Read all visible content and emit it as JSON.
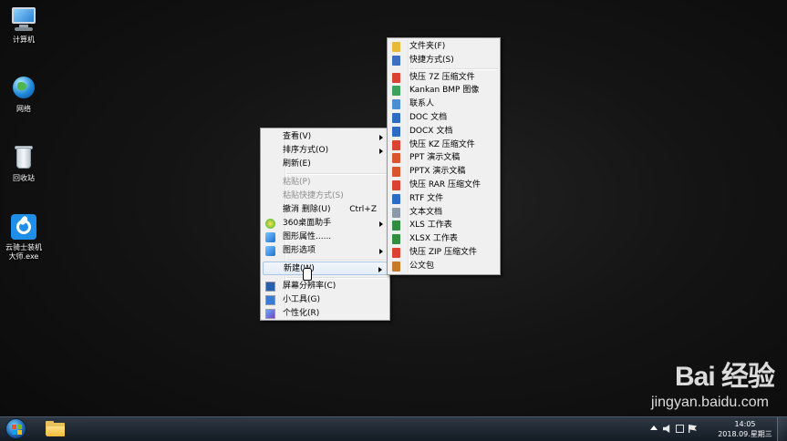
{
  "desktop_icons": [
    {
      "label": "计算机",
      "icon": "computer-icon"
    },
    {
      "label": "网络",
      "icon": "network-icon"
    },
    {
      "label": "回收站",
      "icon": "recycle-bin-icon"
    },
    {
      "label_line1": "云骑士装机",
      "label_line2": "大师.exe",
      "icon": "yunqishi-app-icon"
    }
  ],
  "context_menu": {
    "items": [
      {
        "label": "查看(V)",
        "submenu": true
      },
      {
        "label": "排序方式(O)",
        "submenu": true
      },
      {
        "label": "刷新(E)"
      },
      {
        "label": "粘贴(P)",
        "disabled": true
      },
      {
        "label": "粘贴快捷方式(S)",
        "disabled": true
      },
      {
        "label": "撤消 删除(U)",
        "shortcut": "Ctrl+Z"
      },
      {
        "label": "360桌面助手",
        "submenu": true,
        "icon": "360-icon"
      },
      {
        "label": "图形属性......",
        "icon": "graphics-icon"
      },
      {
        "label": "图形选项",
        "submenu": true,
        "icon": "graphics-options-icon"
      },
      {
        "label": "新建(W)",
        "submenu": true,
        "highlighted": true
      },
      {
        "label": "屏幕分辨率(C)",
        "icon": "screen-resolution-icon"
      },
      {
        "label": "小工具(G)",
        "icon": "gadgets-icon"
      },
      {
        "label": "个性化(R)",
        "icon": "personalize-icon"
      }
    ]
  },
  "new_submenu": {
    "items": [
      {
        "label": "文件夹(F)",
        "icon": "folder-icon",
        "color": "#e9b93a"
      },
      {
        "label": "快捷方式(S)",
        "icon": "shortcut-icon",
        "color": "#3a6fc4"
      },
      {
        "label": "快压 7Z 压缩文件",
        "icon": "archive-icon",
        "color": "#d9432f"
      },
      {
        "label": "Kankan BMP 图像",
        "icon": "image-icon",
        "color": "#3aa35c"
      },
      {
        "label": "联系人",
        "icon": "contact-icon",
        "color": "#4a8fd6"
      },
      {
        "label": "DOC 文档",
        "icon": "doc-icon",
        "color": "#2b6cc4"
      },
      {
        "label": "DOCX 文档",
        "icon": "docx-icon",
        "color": "#2b6cc4"
      },
      {
        "label": "快压 KZ 压缩文件",
        "icon": "archive-icon",
        "color": "#d9432f"
      },
      {
        "label": "PPT 演示文稿",
        "icon": "ppt-icon",
        "color": "#d8572a"
      },
      {
        "label": "PPTX 演示文稿",
        "icon": "pptx-icon",
        "color": "#d8572a"
      },
      {
        "label": "快压 RAR 压缩文件",
        "icon": "archive-icon",
        "color": "#d9432f"
      },
      {
        "label": "RTF 文件",
        "icon": "rtf-icon",
        "color": "#2b6cc4"
      },
      {
        "label": "文本文档",
        "icon": "text-icon",
        "color": "#8a9aa8"
      },
      {
        "label": "XLS 工作表",
        "icon": "xls-icon",
        "color": "#2f8f3e"
      },
      {
        "label": "XLSX 工作表",
        "icon": "xlsx-icon",
        "color": "#2f8f3e"
      },
      {
        "label": "快压 ZIP 压缩文件",
        "icon": "archive-icon",
        "color": "#d9432f"
      },
      {
        "label": "公文包",
        "icon": "briefcase-icon",
        "color": "#c77a2a"
      }
    ]
  },
  "taskbar": {
    "clock_time": "14:05",
    "clock_date": "2018.09.星期三"
  },
  "watermark": {
    "brand": "Bai 经验",
    "site": "jingyan.baidu.com"
  }
}
